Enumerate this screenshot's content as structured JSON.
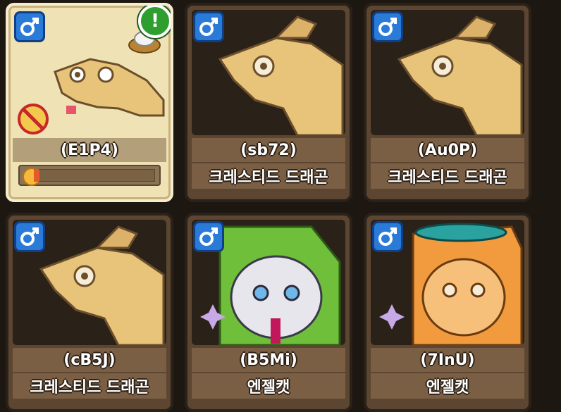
{
  "cards": [
    {
      "id": "(E1P4)",
      "species": "",
      "gender": "male",
      "selected": true,
      "progress": 0.0
    },
    {
      "id": "(sb72)",
      "species": "크레스티드 드래곤",
      "gender": "male"
    },
    {
      "id": "(Au0P)",
      "species": "크레스티드 드래곤",
      "gender": "male"
    },
    {
      "id": "(cB5J)",
      "species": "크레스티드 드래곤",
      "gender": "male"
    },
    {
      "id": "(B5Mi)",
      "species": "엔젤캣",
      "gender": "male"
    },
    {
      "id": "(7InU)",
      "species": "엔젤캣",
      "gender": "male"
    }
  ],
  "alert_symbol": "!",
  "colors": {
    "gender_bg": "#2a7ad8",
    "alert_bg": "#2e9e2f",
    "progress_fill": "#e35b2b"
  }
}
